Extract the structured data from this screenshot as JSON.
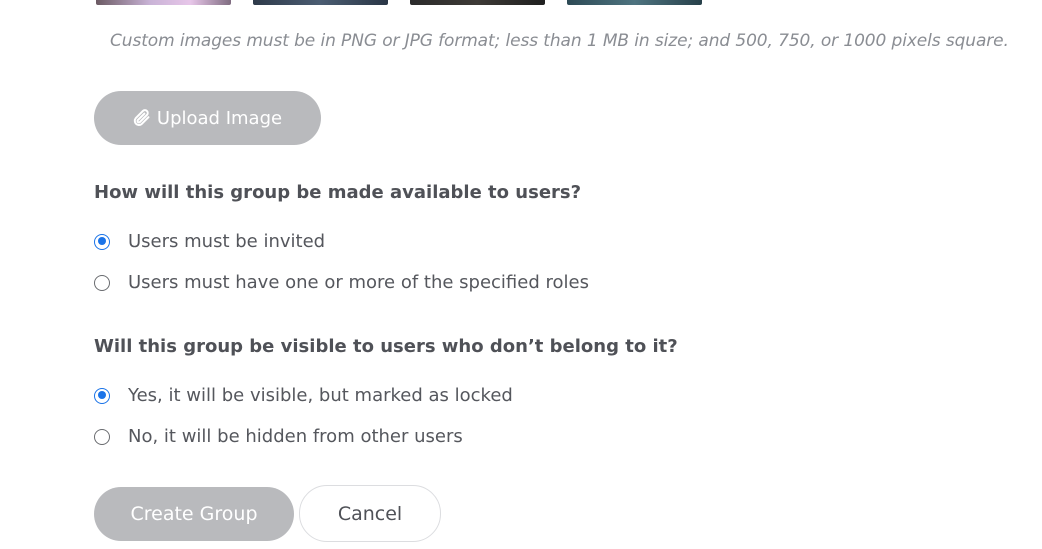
{
  "thumbnails": [
    {
      "name": "thumbnail-1"
    },
    {
      "name": "thumbnail-2"
    },
    {
      "name": "thumbnail-3"
    },
    {
      "name": "thumbnail-4"
    }
  ],
  "image_hint": "Custom images must be in PNG or JPG format; less than 1 MB in size; and 500, 750, or 1000 pixels square.",
  "upload": {
    "label": "Upload Image",
    "icon": "paperclip-icon"
  },
  "availability": {
    "question": "How will this group be made available to users?",
    "options": [
      {
        "label": "Users must be invited",
        "checked": true
      },
      {
        "label": "Users must have one or more of the specified roles",
        "checked": false
      }
    ]
  },
  "visibility": {
    "question": "Will this group be visible to users who don’t belong to it?",
    "options": [
      {
        "label": "Yes, it will be visible, but marked as locked",
        "checked": true
      },
      {
        "label": "No, it will be hidden from other users",
        "checked": false
      }
    ]
  },
  "actions": {
    "create_label": "Create Group",
    "cancel_label": "Cancel"
  },
  "colors": {
    "accent": "#1a73e8",
    "disabled_button": "#b9babd",
    "text": "#55575d",
    "hint": "#8a8d93"
  }
}
